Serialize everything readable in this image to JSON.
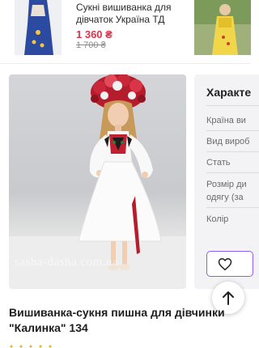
{
  "related_product": {
    "title": "Сукні вишиванка для дівчаток Україна ТД",
    "price": "1 360 ₴",
    "old_price": "1 700 ₴"
  },
  "main_photo": {
    "watermark": "sasha-dasha.com.ua"
  },
  "characteristics": {
    "title": "Характе",
    "rows": [
      "Країна ви",
      "Вид вироб",
      "Стать",
      "Розмір ди",
      "одягу (за",
      "Колір"
    ]
  },
  "icons": {
    "wishlist": "heart-icon",
    "scroll_top": "arrow-up-icon"
  },
  "colors": {
    "accent": "#8b5cf6",
    "price": "#d9354f"
  },
  "product": {
    "title": "Вишиванка-сукня пишна для дівчинки \"Калинка\" 134"
  }
}
